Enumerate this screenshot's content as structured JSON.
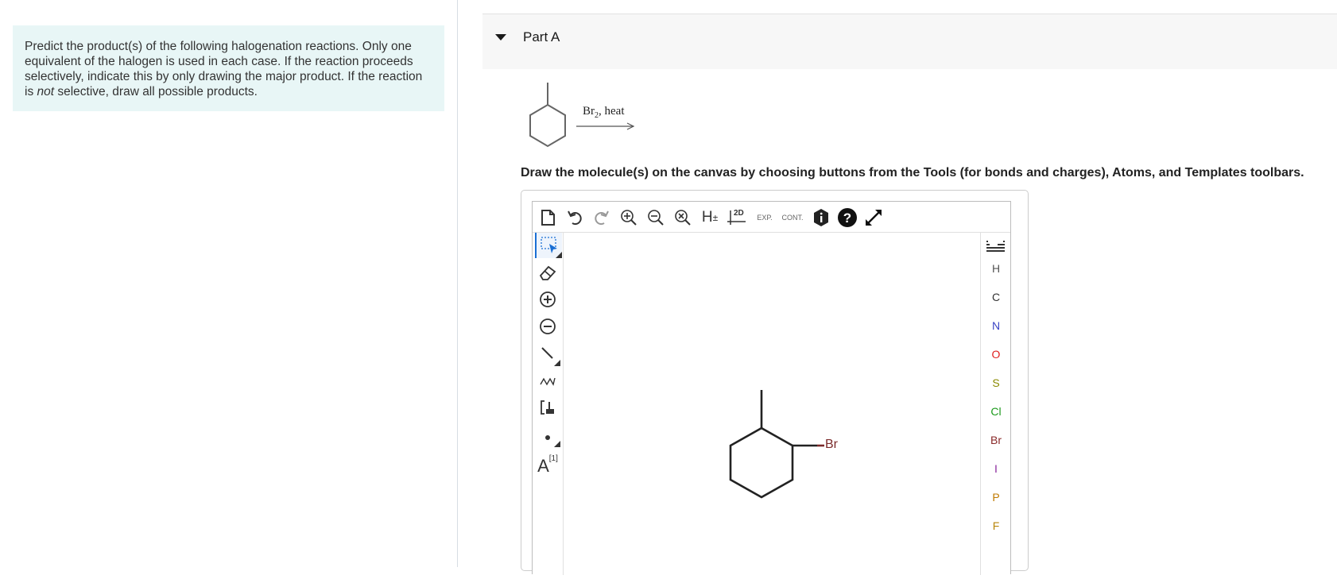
{
  "question": {
    "intro_part1": "Predict the product(s) of the following halogenation reactions. Only one equivalent of the halogen is used in each case. If the reaction proceeds selectively, indicate this by only drawing the major product. If the reaction is ",
    "intro_emphasis": "not",
    "intro_part2": " selective, draw all possible products."
  },
  "part": {
    "title": "Part A",
    "reagent_main": "Br",
    "reagent_sub": "2",
    "reagent_rest": ", heat",
    "instructions": "Draw the molecule(s) on the canvas by choosing buttons from the Tools (for bonds and charges), Atoms, and Templates toolbars."
  },
  "editor": {
    "top_toolbar": {
      "h_label": "H",
      "h_pm": "±",
      "twod_label": "2D",
      "exp_label": "EXP.",
      "cont_label": "CONT."
    },
    "left_toolbar": {
      "atom_label": "A",
      "atom_map": "[1]"
    },
    "atoms": [
      {
        "symbol": "H",
        "color": "#555555"
      },
      {
        "symbol": "C",
        "color": "#333333"
      },
      {
        "symbol": "N",
        "color": "#3b43c4"
      },
      {
        "symbol": "O",
        "color": "#e02020"
      },
      {
        "symbol": "S",
        "color": "#8a8a00"
      },
      {
        "symbol": "Cl",
        "color": "#1d9a1d"
      },
      {
        "symbol": "Br",
        "color": "#8a2a2a"
      },
      {
        "symbol": "I",
        "color": "#8b2a9e"
      },
      {
        "symbol": "P",
        "color": "#c07a00"
      },
      {
        "symbol": "F",
        "color": "#b8860b"
      }
    ],
    "molecule": {
      "substituent_label": "Br",
      "substituent_color": "#7a2a2a"
    }
  }
}
